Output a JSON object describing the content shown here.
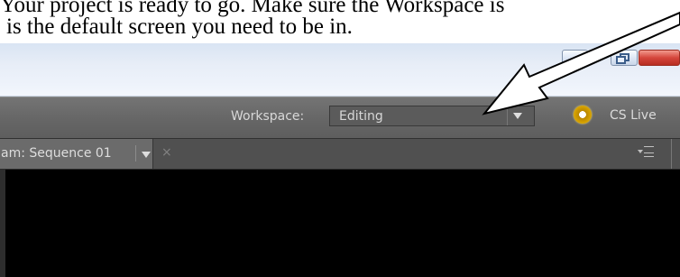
{
  "document": {
    "line1": "Your project is ready to go. Make sure the Workspace is",
    "line2": "is the default screen you need to be in."
  },
  "app": {
    "workspace_label": "Workspace:",
    "workspace_value": "Editing",
    "cs_live_label": "CS Live",
    "panel_tab_label": "am: Sequence 01",
    "close_tab_glyph": "×"
  },
  "icons": {
    "minimize": "minimize-icon",
    "restore": "restore-icon",
    "close": "window-close-icon",
    "workspace_dropdown": "chevron-down-icon",
    "cs_live": "cs-live-icon",
    "tab_menu": "chevron-down-icon",
    "panel_menu": "panel-menu-icon",
    "callout_arrow": "arrow-icon"
  },
  "colors": {
    "ui_dark": "#505050",
    "ui_mid": "#666666",
    "dropdown": "#5b5b5b",
    "close_button": "#d5463c",
    "cs_live_gold": "#d7a300"
  }
}
